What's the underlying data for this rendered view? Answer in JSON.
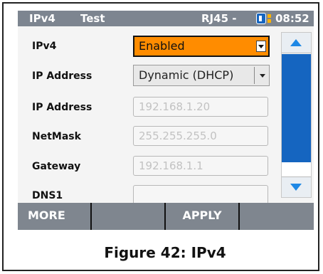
{
  "statusbar": {
    "tab1": "IPv4",
    "tab2": "Test",
    "port": "RJ45 -",
    "time": "08:52",
    "battery_color": "#1565c0",
    "signal_color": "#ffb300"
  },
  "form": {
    "rows": [
      {
        "label": "IPv4",
        "value": "Enabled"
      },
      {
        "label": "IP Address",
        "value": "Dynamic (DHCP)"
      },
      {
        "label": "IP Address",
        "placeholder": "192.168.1.20"
      },
      {
        "label": "NetMask",
        "placeholder": "255.255.255.0"
      },
      {
        "label": "Gateway",
        "placeholder": "192.168.1.1"
      },
      {
        "label": "DNS1",
        "placeholder": ""
      }
    ],
    "accent_color": "#ff8c00"
  },
  "softkeys": {
    "more": "MORE",
    "apply": "APPLY"
  },
  "caption": "Figure 42: IPv4"
}
